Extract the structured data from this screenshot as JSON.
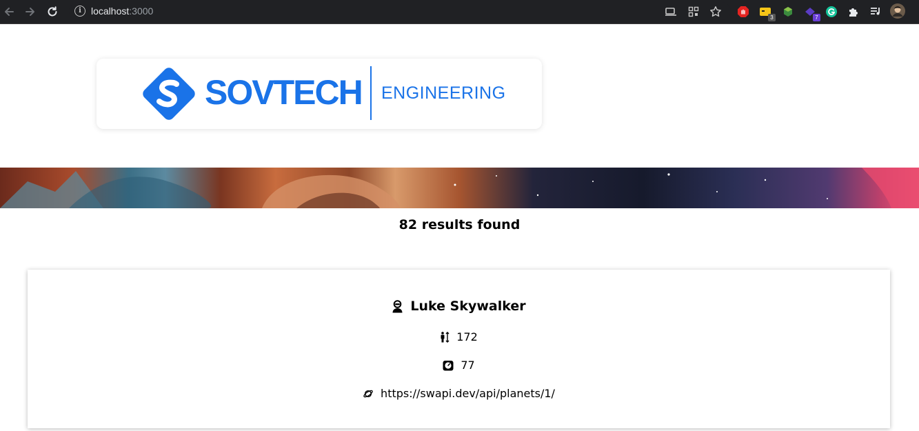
{
  "browser": {
    "url_host": "localhost",
    "url_port": ":3000",
    "extensions": [
      {
        "icon": "adblock-icon",
        "color": "#e52421"
      },
      {
        "icon": "notes-extension-icon",
        "color": "#f5c518",
        "badge": "3"
      },
      {
        "icon": "cube-extension-icon",
        "color": "#4caf50"
      },
      {
        "icon": "shape-extension-icon",
        "color": "#5b3cc4",
        "badge": "7"
      },
      {
        "icon": "grammarly-icon",
        "color": "#15c39a"
      }
    ]
  },
  "logo": {
    "brand": "SOVTECH",
    "subtitle": "ENGINEERING",
    "color": "#1a73e8"
  },
  "results": {
    "text": "82 results found"
  },
  "character": {
    "name": "Luke Skywalker",
    "height": "172",
    "mass": "77",
    "homeworld": "https://swapi.dev/api/planets/1/"
  }
}
